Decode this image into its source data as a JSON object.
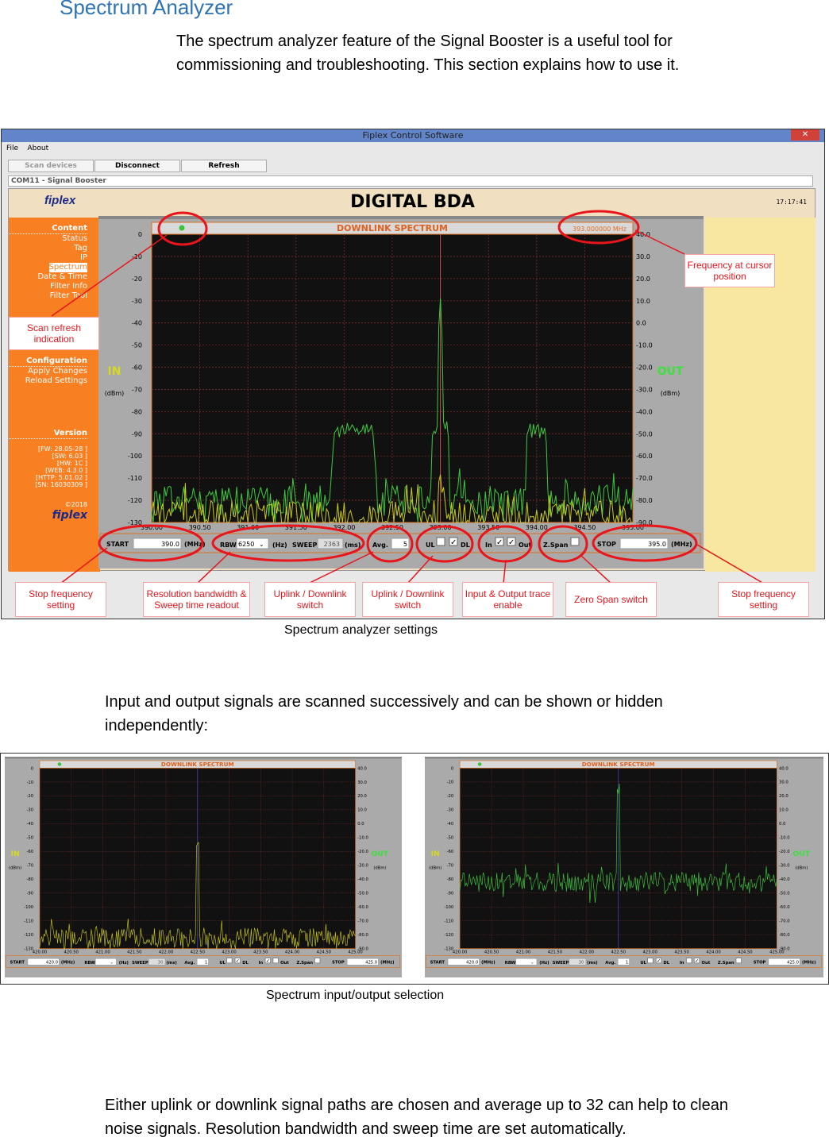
{
  "heading": "Spectrum Analyzer",
  "intro": "The spectrum analyzer feature of the Signal Booster is a useful tool for commissioning and troubleshooting. This section explains how to use it.",
  "window": {
    "title": "Fiplex Control Software",
    "menu": [
      "File",
      "About"
    ],
    "buttons": {
      "scan": "Scan devices",
      "disconnect": "Disconnect",
      "refresh": "Refresh"
    },
    "device": "COM11 - Signal Booster",
    "app_title": "DIGITAL BDA",
    "logo": "fiplex",
    "clock": "17:17:41"
  },
  "sidebar": {
    "content_header": "Content",
    "content_items": [
      "Status",
      "Tag",
      "IP",
      "Spectrum",
      "Date & Time",
      "Filter Info",
      "Filter Tool"
    ],
    "selected": "Spectrum",
    "config_header": "Configuration",
    "config_items": [
      "Apply Changes",
      "Reload Settings"
    ],
    "version_header": "Version",
    "versions": [
      "[FW: 28.05-28 ]",
      "[SW: 6.03 ]",
      "[HW:   1C ]",
      "[WEB: 4.3.0 ]",
      "[HTTP: 5.01.02 ]",
      "[SN: 16030309 ]"
    ],
    "copyright": "©2018"
  },
  "callouts": {
    "scan_refresh": "Scan refresh indication",
    "freq_cursor": "Frequency at cursor position",
    "start": "Stop frequency setting",
    "rbw": "Resolution bandwidth & Sweep time readout",
    "ul_dl_1": "Uplink / Downlink switch",
    "ul_dl_2": "Uplink / Downlink switch",
    "in_out": "Input & Output trace enable",
    "zspan": "Zero Span switch",
    "stop": "Stop frequency setting"
  },
  "caption1": "Spectrum analyzer settings",
  "para2": "Input and output signals are scanned successively and can be shown or hidden independently:",
  "caption2": "Spectrum input/output selection",
  "para3": "Either uplink or downlink signal paths are chosen and average up to 32 can help to clean noise signals. Resolution bandwidth and sweep time are set automatically.",
  "colors": {
    "heading": "#2e74b5",
    "sidebar": "#f87f22",
    "annotation": "#e8151b",
    "in_trace": "#c8c81e",
    "out_trace": "#3ec83e"
  },
  "chart_data": [
    {
      "type": "line",
      "title": "DOWNLINK SPECTRUM",
      "cursor_readout": "393.000000 MHz",
      "left_axis": {
        "label": "IN",
        "unit": "(dBm)",
        "ylim": [
          -130,
          0
        ],
        "ticks": [
          0,
          -10,
          -20,
          -30,
          -40,
          -50,
          -60,
          -70,
          -80,
          -90,
          -100,
          -110,
          -120,
          -130
        ]
      },
      "right_axis": {
        "label": "OUT",
        "unit": "(dBm)",
        "ylim": [
          -90,
          40
        ],
        "ticks": [
          "40.0",
          "30.0",
          "20.0",
          "10.0",
          "0.0",
          "-10.0",
          "-20.0",
          "-30.0",
          "-40.0",
          "-50.0",
          "-60.0",
          "-70.0",
          "-80.0",
          "-90.0"
        ]
      },
      "xlim": [
        390,
        395
      ],
      "xticks": [
        "390.00",
        "390.50",
        "391.00",
        "391.50",
        "392.00",
        "392.50",
        "393.00",
        "393.50",
        "394.00",
        "394.50",
        "395.00"
      ],
      "grid": true,
      "series": [
        {
          "name": "Out",
          "color": "#3ec83e",
          "noise_floor_dbm": -120,
          "peaks": [
            {
              "mhz": 392.1,
              "dbm": -88,
              "width_mhz": 0.25
            },
            {
              "mhz": 393.0,
              "dbm": -30,
              "width_mhz": 0.02
            },
            {
              "mhz": 393.0,
              "dbm": -88,
              "width_mhz": 0.1
            },
            {
              "mhz": 394.0,
              "dbm": -88,
              "width_mhz": 0.12
            }
          ]
        },
        {
          "name": "In",
          "color": "#c8c81e",
          "noise_floor_dbm": -127,
          "peaks": [
            {
              "mhz": 393.0,
              "dbm": -112,
              "width_mhz": 0.02
            }
          ]
        }
      ],
      "controls": {
        "start_label": "START",
        "start": "390.0",
        "mhz": "(MHz)",
        "rbw_label": "RBW",
        "rbw": "6250",
        "hz": "(Hz)",
        "sweep_label": "SWEEP",
        "sweep": "2363",
        "ms": "(ms)",
        "avg_label": "Avg.",
        "avg": "5",
        "ul": "UL",
        "dl": "DL",
        "ul_checked": false,
        "dl_checked": true,
        "in": "In",
        "out": "Out",
        "in_checked": true,
        "out_checked": true,
        "zspan": "Z.Span",
        "zspan_checked": false,
        "stop_label": "STOP",
        "stop": "395.0"
      }
    },
    {
      "type": "line",
      "title": "DOWNLINK SPECTRUM",
      "left_axis": {
        "label": "IN",
        "unit": "(dBm)",
        "ylim": [
          -130,
          0
        ],
        "ticks": [
          0,
          -10,
          -20,
          -30,
          -40,
          -50,
          -60,
          -70,
          -80,
          -90,
          -100,
          -110,
          -120,
          -130
        ]
      },
      "right_axis": {
        "label": "OUT",
        "unit": "(dBm)",
        "ylim": [
          -90,
          40
        ],
        "ticks": [
          "40.0",
          "30.0",
          "20.0",
          "10.0",
          "0.0",
          "-10.0",
          "-20.0",
          "-30.0",
          "-40.0",
          "-50.0",
          "-60.0",
          "-70.0",
          "-80.0",
          "-90.0"
        ]
      },
      "xlim": [
        420,
        425
      ],
      "xticks": [
        "420.00",
        "420.50",
        "421.00",
        "421.50",
        "422.00",
        "422.50",
        "423.00",
        "423.50",
        "424.00",
        "424.50",
        "425.00"
      ],
      "grid": true,
      "series": [
        {
          "name": "In",
          "color": "#c8c81e",
          "noise_floor_dbm": -122,
          "peaks": [
            {
              "mhz": 422.5,
              "dbm": -53,
              "width_mhz": 0.03
            }
          ]
        }
      ],
      "controls": {
        "start_label": "START",
        "start": "420.0",
        "mhz": "(MHz)",
        "rbw_label": "RBW",
        "rbw": "",
        "hz": "(Hz)",
        "sweep_label": "SWEEP",
        "sweep": "30",
        "ms": "(ms)",
        "avg_label": "Avg.",
        "avg": "1",
        "ul": "UL",
        "dl": "DL",
        "ul_checked": false,
        "dl_checked": true,
        "in": "In",
        "out": "Out",
        "in_checked": true,
        "out_checked": false,
        "zspan": "Z.Span",
        "zspan_checked": false,
        "stop_label": "STOP",
        "stop": "425.0"
      }
    },
    {
      "type": "line",
      "title": "DOWNLINK SPECTRUM",
      "left_axis": {
        "label": "IN",
        "unit": "(dBm)",
        "ylim": [
          -130,
          0
        ],
        "ticks": [
          0,
          -10,
          -20,
          -30,
          -40,
          -50,
          -60,
          -70,
          -80,
          -90,
          -100,
          -110,
          -120,
          -130
        ]
      },
      "right_axis": {
        "label": "OUT",
        "unit": "(dBm)",
        "ylim": [
          -90,
          40
        ],
        "ticks": [
          "40.0",
          "30.0",
          "20.0",
          "10.0",
          "0.0",
          "-10.0",
          "-20.0",
          "-30.0",
          "-40.0",
          "-50.0",
          "-60.0",
          "-70.0",
          "-80.0",
          "-90.0"
        ]
      },
      "xlim": [
        420,
        425
      ],
      "xticks": [
        "420.00",
        "420.50",
        "421.00",
        "421.50",
        "422.00",
        "422.50",
        "423.00",
        "423.50",
        "424.00",
        "424.50",
        "425.00"
      ],
      "grid": true,
      "series": [
        {
          "name": "Out",
          "color": "#3ec83e",
          "noise_floor_dbm": -82,
          "peaks": [
            {
              "mhz": 422.5,
              "dbm": -15,
              "width_mhz": 0.03
            }
          ]
        }
      ],
      "controls": {
        "start_label": "START",
        "start": "420.0",
        "mhz": "(MHz)",
        "rbw_label": "RBW",
        "rbw": "",
        "hz": "(Hz)",
        "sweep_label": "SWEEP",
        "sweep": "30",
        "ms": "(ms)",
        "avg_label": "Avg.",
        "avg": "1",
        "ul": "UL",
        "dl": "DL",
        "ul_checked": false,
        "dl_checked": true,
        "in": "In",
        "out": "Out",
        "in_checked": false,
        "out_checked": true,
        "zspan": "Z.Span",
        "zspan_checked": false,
        "stop_label": "STOP",
        "stop": "425.0"
      }
    }
  ]
}
